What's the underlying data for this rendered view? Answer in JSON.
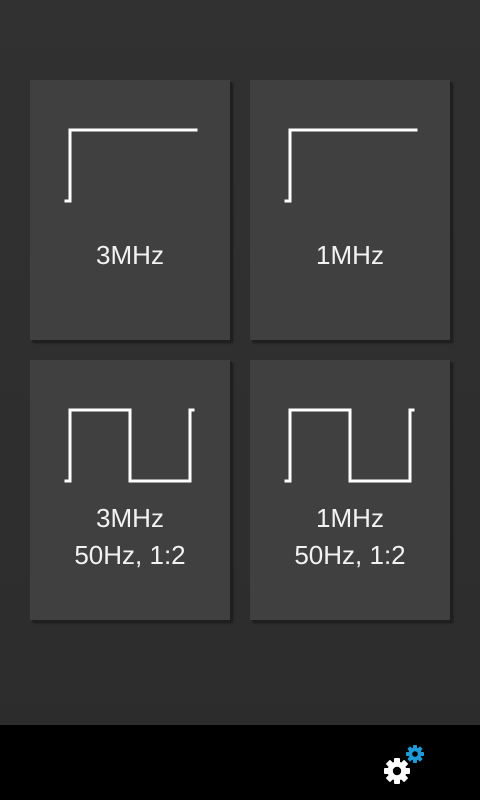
{
  "colors": {
    "background": "#2e2e2e",
    "tile": "#404040",
    "text": "#f2f2f2",
    "waveform": "#ffffff",
    "bottom_bar": "#000000",
    "gear_main": "#ffffff",
    "gear_accent": "#1e9ad6"
  },
  "tiles": [
    {
      "waveform": "step",
      "line1": "3MHz",
      "line2": ""
    },
    {
      "waveform": "step",
      "line1": "1MHz",
      "line2": ""
    },
    {
      "waveform": "square",
      "line1": "3MHz",
      "line2": "50Hz, 1:2"
    },
    {
      "waveform": "square",
      "line1": "1MHz",
      "line2": "50Hz, 1:2"
    }
  ],
  "toolbar": {
    "settings_icon": "gear-icon"
  }
}
